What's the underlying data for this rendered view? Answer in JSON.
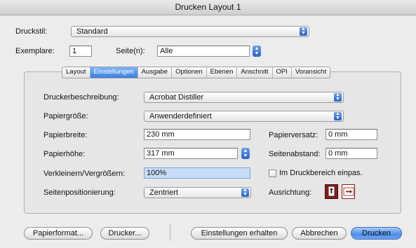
{
  "window": {
    "title": "Drucken Layout 1"
  },
  "druckstil": {
    "label": "Druckstil:",
    "value": "Standard"
  },
  "exemplare": {
    "label": "Exemplare:",
    "value": "1"
  },
  "seiten": {
    "label": "Seite(n):",
    "value": "Alle"
  },
  "tabs": [
    {
      "label": "Layout"
    },
    {
      "label": "Einstellungen"
    },
    {
      "label": "Ausgabe"
    },
    {
      "label": "Optionen"
    },
    {
      "label": "Ebenen"
    },
    {
      "label": "Anschnitt"
    },
    {
      "label": "OPI"
    },
    {
      "label": "Voransicht"
    }
  ],
  "settings": {
    "druckerbeschreibung": {
      "label": "Druckerbeschreibung:",
      "value": "Acrobat Distiller"
    },
    "papiergroesse": {
      "label": "Papiergröße:",
      "value": "Anwenderdefiniert"
    },
    "papierbreite": {
      "label": "Papierbreite:",
      "value": "230 mm"
    },
    "papierhoehe": {
      "label": "Papierhöhe:",
      "value": "317 mm"
    },
    "verkleinern": {
      "label": "Verkleinern/Vergrößern:",
      "value": "100%"
    },
    "seitenpositionierung": {
      "label": "Seitenpositionierung:",
      "value": "Zentriert"
    },
    "papierversatz": {
      "label": "Papierversatz:",
      "value": "0 mm"
    },
    "seitenabstand": {
      "label": "Seitenabstand:",
      "value": "0 mm"
    },
    "einpassen": {
      "label": "Im Druckbereich einpas.",
      "checked": false
    },
    "ausrichtung": {
      "label": "Ausrichtung:"
    }
  },
  "buttons": {
    "papierformat": "Papierformat...",
    "drucker": "Drucker...",
    "einstellungen_erhalten": "Einstellungen erhalten",
    "abbrechen": "Abbrechen",
    "drucken": "Drucken"
  },
  "colors": {
    "accent": "#3d7fe0",
    "orientation_selected": "#8b1a1a"
  }
}
